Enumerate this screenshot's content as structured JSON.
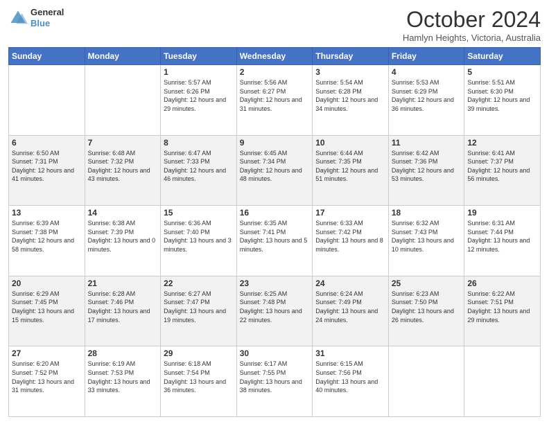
{
  "header": {
    "logo_line1": "General",
    "logo_line2": "Blue",
    "month": "October 2024",
    "location": "Hamlyn Heights, Victoria, Australia"
  },
  "weekdays": [
    "Sunday",
    "Monday",
    "Tuesday",
    "Wednesday",
    "Thursday",
    "Friday",
    "Saturday"
  ],
  "weeks": [
    [
      {
        "day": "",
        "info": ""
      },
      {
        "day": "",
        "info": ""
      },
      {
        "day": "1",
        "info": "Sunrise: 5:57 AM\nSunset: 6:26 PM\nDaylight: 12 hours and 29 minutes."
      },
      {
        "day": "2",
        "info": "Sunrise: 5:56 AM\nSunset: 6:27 PM\nDaylight: 12 hours and 31 minutes."
      },
      {
        "day": "3",
        "info": "Sunrise: 5:54 AM\nSunset: 6:28 PM\nDaylight: 12 hours and 34 minutes."
      },
      {
        "day": "4",
        "info": "Sunrise: 5:53 AM\nSunset: 6:29 PM\nDaylight: 12 hours and 36 minutes."
      },
      {
        "day": "5",
        "info": "Sunrise: 5:51 AM\nSunset: 6:30 PM\nDaylight: 12 hours and 39 minutes."
      }
    ],
    [
      {
        "day": "6",
        "info": "Sunrise: 6:50 AM\nSunset: 7:31 PM\nDaylight: 12 hours and 41 minutes."
      },
      {
        "day": "7",
        "info": "Sunrise: 6:48 AM\nSunset: 7:32 PM\nDaylight: 12 hours and 43 minutes."
      },
      {
        "day": "8",
        "info": "Sunrise: 6:47 AM\nSunset: 7:33 PM\nDaylight: 12 hours and 46 minutes."
      },
      {
        "day": "9",
        "info": "Sunrise: 6:45 AM\nSunset: 7:34 PM\nDaylight: 12 hours and 48 minutes."
      },
      {
        "day": "10",
        "info": "Sunrise: 6:44 AM\nSunset: 7:35 PM\nDaylight: 12 hours and 51 minutes."
      },
      {
        "day": "11",
        "info": "Sunrise: 6:42 AM\nSunset: 7:36 PM\nDaylight: 12 hours and 53 minutes."
      },
      {
        "day": "12",
        "info": "Sunrise: 6:41 AM\nSunset: 7:37 PM\nDaylight: 12 hours and 56 minutes."
      }
    ],
    [
      {
        "day": "13",
        "info": "Sunrise: 6:39 AM\nSunset: 7:38 PM\nDaylight: 12 hours and 58 minutes."
      },
      {
        "day": "14",
        "info": "Sunrise: 6:38 AM\nSunset: 7:39 PM\nDaylight: 13 hours and 0 minutes."
      },
      {
        "day": "15",
        "info": "Sunrise: 6:36 AM\nSunset: 7:40 PM\nDaylight: 13 hours and 3 minutes."
      },
      {
        "day": "16",
        "info": "Sunrise: 6:35 AM\nSunset: 7:41 PM\nDaylight: 13 hours and 5 minutes."
      },
      {
        "day": "17",
        "info": "Sunrise: 6:33 AM\nSunset: 7:42 PM\nDaylight: 13 hours and 8 minutes."
      },
      {
        "day": "18",
        "info": "Sunrise: 6:32 AM\nSunset: 7:43 PM\nDaylight: 13 hours and 10 minutes."
      },
      {
        "day": "19",
        "info": "Sunrise: 6:31 AM\nSunset: 7:44 PM\nDaylight: 13 hours and 12 minutes."
      }
    ],
    [
      {
        "day": "20",
        "info": "Sunrise: 6:29 AM\nSunset: 7:45 PM\nDaylight: 13 hours and 15 minutes."
      },
      {
        "day": "21",
        "info": "Sunrise: 6:28 AM\nSunset: 7:46 PM\nDaylight: 13 hours and 17 minutes."
      },
      {
        "day": "22",
        "info": "Sunrise: 6:27 AM\nSunset: 7:47 PM\nDaylight: 13 hours and 19 minutes."
      },
      {
        "day": "23",
        "info": "Sunrise: 6:25 AM\nSunset: 7:48 PM\nDaylight: 13 hours and 22 minutes."
      },
      {
        "day": "24",
        "info": "Sunrise: 6:24 AM\nSunset: 7:49 PM\nDaylight: 13 hours and 24 minutes."
      },
      {
        "day": "25",
        "info": "Sunrise: 6:23 AM\nSunset: 7:50 PM\nDaylight: 13 hours and 26 minutes."
      },
      {
        "day": "26",
        "info": "Sunrise: 6:22 AM\nSunset: 7:51 PM\nDaylight: 13 hours and 29 minutes."
      }
    ],
    [
      {
        "day": "27",
        "info": "Sunrise: 6:20 AM\nSunset: 7:52 PM\nDaylight: 13 hours and 31 minutes."
      },
      {
        "day": "28",
        "info": "Sunrise: 6:19 AM\nSunset: 7:53 PM\nDaylight: 13 hours and 33 minutes."
      },
      {
        "day": "29",
        "info": "Sunrise: 6:18 AM\nSunset: 7:54 PM\nDaylight: 13 hours and 36 minutes."
      },
      {
        "day": "30",
        "info": "Sunrise: 6:17 AM\nSunset: 7:55 PM\nDaylight: 13 hours and 38 minutes."
      },
      {
        "day": "31",
        "info": "Sunrise: 6:15 AM\nSunset: 7:56 PM\nDaylight: 13 hours and 40 minutes."
      },
      {
        "day": "",
        "info": ""
      },
      {
        "day": "",
        "info": ""
      }
    ]
  ]
}
